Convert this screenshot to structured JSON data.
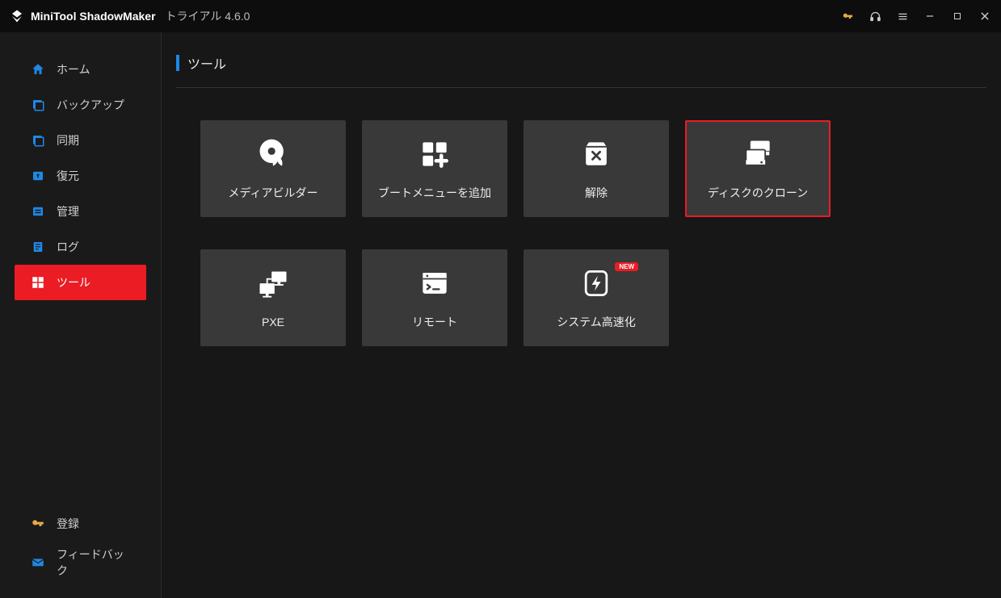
{
  "titlebar": {
    "app_name": "MiniTool ShadowMaker",
    "app_edition": "トライアル 4.6.0"
  },
  "sidebar": {
    "items": [
      {
        "label": "ホーム"
      },
      {
        "label": "バックアップ"
      },
      {
        "label": "同期"
      },
      {
        "label": "復元"
      },
      {
        "label": "管理"
      },
      {
        "label": "ログ"
      },
      {
        "label": "ツール"
      }
    ],
    "bottom": [
      {
        "label": "登録"
      },
      {
        "label": "フィードバック"
      }
    ]
  },
  "content": {
    "title": "ツール",
    "tools": [
      {
        "label": "メディアビルダー"
      },
      {
        "label": "ブートメニューを追加"
      },
      {
        "label": "解除"
      },
      {
        "label": "ディスクのクローン"
      },
      {
        "label": "PXE"
      },
      {
        "label": "リモート"
      },
      {
        "label": "システム高速化",
        "badge": "NEW"
      }
    ]
  }
}
